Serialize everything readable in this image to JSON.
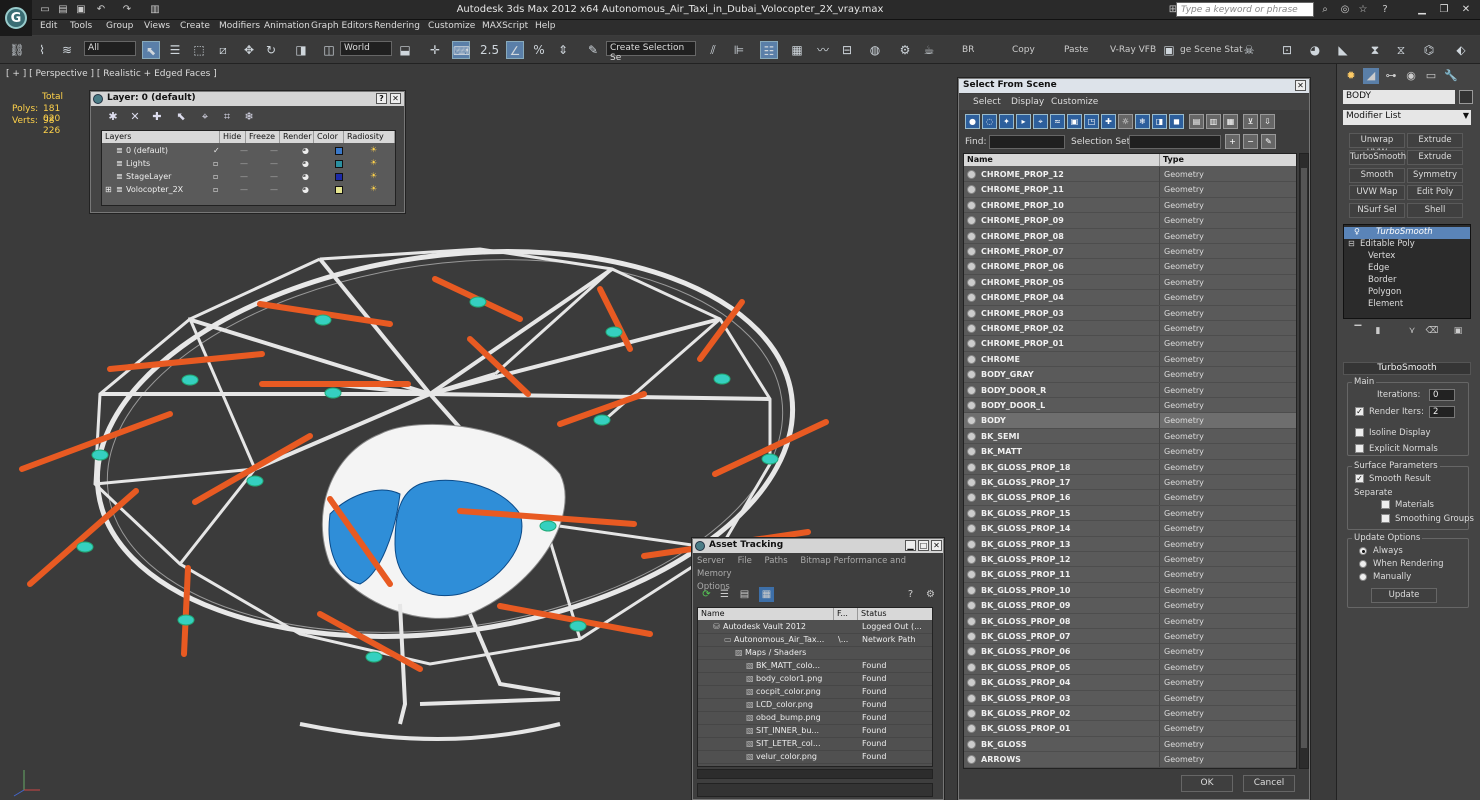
{
  "window": {
    "title": "Autodesk 3ds Max  2012 x64     Autonomous_Air_Taxi_in_Dubai_Volocopter_2X_vray.max",
    "search_placeholder": "Type a keyword or phrase"
  },
  "menu": [
    "Edit",
    "Tools",
    "Group",
    "Views",
    "Create",
    "Modifiers",
    "Animation",
    "Graph Editors",
    "Rendering",
    "Customize",
    "MAXScript",
    "Help"
  ],
  "toolbar": {
    "selection_filter": "All",
    "coord_system": "World",
    "snap_value": "2.5",
    "named_selection_placeholder": "Create Selection Se",
    "br_label": "BR",
    "copy_label": "Copy",
    "paste_label": "Paste",
    "vray_vfb_label": "V-Ray VFB",
    "scene_states_label": "ge Scene Stat"
  },
  "viewport": {
    "label": "[ + ] [ Perspective ] [ Realistic + Edged Faces ]",
    "stats": {
      "total_label": "Total",
      "polys_label": "Polys:",
      "polys_value": "181 020",
      "verts_label": "Verts:",
      "verts_value": "98 226"
    }
  },
  "layer_dialog": {
    "title": "Layer: 0 (default)",
    "columns": [
      "Layers",
      "Hide",
      "Freeze",
      "Render",
      "Color",
      "Radiosity"
    ],
    "rows": [
      {
        "name": "0 (default)",
        "current": "✓",
        "color": "#3a78c8"
      },
      {
        "name": "Lights",
        "current": "",
        "color": "#2a8fa0"
      },
      {
        "name": "StageLayer",
        "current": "",
        "color": "#1c2aa8"
      },
      {
        "name": "Volocopter_2X",
        "current": "",
        "color": "#e8e890"
      }
    ]
  },
  "select_from_scene": {
    "title": "Select From Scene",
    "menu": [
      "Select",
      "Display",
      "Customize"
    ],
    "find_label": "Find:",
    "selection_set_label": "Selection Set:",
    "col_name": "Name",
    "col_type": "Type",
    "ok_label": "OK",
    "cancel_label": "Cancel",
    "objects": [
      {
        "name": "CHROME_PROP_12",
        "type": "Geometry"
      },
      {
        "name": "CHROME_PROP_11",
        "type": "Geometry"
      },
      {
        "name": "CHROME_PROP_10",
        "type": "Geometry"
      },
      {
        "name": "CHROME_PROP_09",
        "type": "Geometry"
      },
      {
        "name": "CHROME_PROP_08",
        "type": "Geometry"
      },
      {
        "name": "CHROME_PROP_07",
        "type": "Geometry"
      },
      {
        "name": "CHROME_PROP_06",
        "type": "Geometry"
      },
      {
        "name": "CHROME_PROP_05",
        "type": "Geometry"
      },
      {
        "name": "CHROME_PROP_04",
        "type": "Geometry"
      },
      {
        "name": "CHROME_PROP_03",
        "type": "Geometry"
      },
      {
        "name": "CHROME_PROP_02",
        "type": "Geometry"
      },
      {
        "name": "CHROME_PROP_01",
        "type": "Geometry"
      },
      {
        "name": "CHROME",
        "type": "Geometry"
      },
      {
        "name": "BODY_GRAY",
        "type": "Geometry"
      },
      {
        "name": "BODY_DOOR_R",
        "type": "Geometry"
      },
      {
        "name": "BODY_DOOR_L",
        "type": "Geometry"
      },
      {
        "name": "BODY",
        "type": "Geometry",
        "selected": true
      },
      {
        "name": "BK_SEMI",
        "type": "Geometry"
      },
      {
        "name": "BK_MATT",
        "type": "Geometry"
      },
      {
        "name": "BK_GLOSS_PROP_18",
        "type": "Geometry"
      },
      {
        "name": "BK_GLOSS_PROP_17",
        "type": "Geometry"
      },
      {
        "name": "BK_GLOSS_PROP_16",
        "type": "Geometry"
      },
      {
        "name": "BK_GLOSS_PROP_15",
        "type": "Geometry"
      },
      {
        "name": "BK_GLOSS_PROP_14",
        "type": "Geometry"
      },
      {
        "name": "BK_GLOSS_PROP_13",
        "type": "Geometry"
      },
      {
        "name": "BK_GLOSS_PROP_12",
        "type": "Geometry"
      },
      {
        "name": "BK_GLOSS_PROP_11",
        "type": "Geometry"
      },
      {
        "name": "BK_GLOSS_PROP_10",
        "type": "Geometry"
      },
      {
        "name": "BK_GLOSS_PROP_09",
        "type": "Geometry"
      },
      {
        "name": "BK_GLOSS_PROP_08",
        "type": "Geometry"
      },
      {
        "name": "BK_GLOSS_PROP_07",
        "type": "Geometry"
      },
      {
        "name": "BK_GLOSS_PROP_06",
        "type": "Geometry"
      },
      {
        "name": "BK_GLOSS_PROP_05",
        "type": "Geometry"
      },
      {
        "name": "BK_GLOSS_PROP_04",
        "type": "Geometry"
      },
      {
        "name": "BK_GLOSS_PROP_03",
        "type": "Geometry"
      },
      {
        "name": "BK_GLOSS_PROP_02",
        "type": "Geometry"
      },
      {
        "name": "BK_GLOSS_PROP_01",
        "type": "Geometry"
      },
      {
        "name": "BK_GLOSS",
        "type": "Geometry"
      },
      {
        "name": "ARROWS",
        "type": "Geometry"
      }
    ]
  },
  "asset_tracking": {
    "title": "Asset Tracking",
    "menu": [
      "Server",
      "File",
      "Paths",
      "Bitmap Performance and Memory",
      "Options"
    ],
    "col_name": "Name",
    "col_path": "F...",
    "col_status": "Status",
    "rows": [
      {
        "name": "Autodesk Vault 2012",
        "path": "",
        "status": "Logged Out (...",
        "indent": 1
      },
      {
        "name": "Autonomous_Air_Tax...",
        "path": "\\...",
        "status": "Network Path",
        "indent": 2
      },
      {
        "name": "Maps / Shaders",
        "path": "",
        "status": "",
        "indent": 3
      },
      {
        "name": "BK_MATT_colo...",
        "path": "",
        "status": "Found",
        "indent": 4
      },
      {
        "name": "body_color1.png",
        "path": "",
        "status": "Found",
        "indent": 4
      },
      {
        "name": "cocpit_color.png",
        "path": "",
        "status": "Found",
        "indent": 4
      },
      {
        "name": "LCD_color.png",
        "path": "",
        "status": "Found",
        "indent": 4
      },
      {
        "name": "obod_bump.png",
        "path": "",
        "status": "Found",
        "indent": 4
      },
      {
        "name": "SIT_INNER_bu...",
        "path": "",
        "status": "Found",
        "indent": 4
      },
      {
        "name": "SIT_LETER_col...",
        "path": "",
        "status": "Found",
        "indent": 4
      },
      {
        "name": "velur_color.png",
        "path": "",
        "status": "Found",
        "indent": 4
      }
    ]
  },
  "command_panel": {
    "object_name": "BODY",
    "modifier_list": "Modifier List",
    "buttons": [
      "Unwrap UVW",
      "Extrude",
      "TurboSmooth",
      "Extrude",
      "Smooth",
      "Symmetry",
      "UVW Map",
      "Edit Poly",
      "NSurf Sel",
      "Shell"
    ],
    "stack": [
      "TurboSmooth",
      "Editable Poly",
      "Vertex",
      "Edge",
      "Border",
      "Polygon",
      "Element"
    ],
    "turbosmooth": {
      "header": "TurboSmooth",
      "main_label": "Main",
      "iterations_label": "Iterations:",
      "iterations_value": "0",
      "render_iters_label": "Render Iters:",
      "render_iters_value": "2",
      "isoline_label": "Isoline Display",
      "explicit_normals_label": "Explicit Normals",
      "surface_params_label": "Surface Parameters",
      "smooth_result_label": "Smooth Result",
      "separate_label": "Separate",
      "materials_label": "Materials",
      "smoothing_groups_label": "Smoothing Groups",
      "update_options_label": "Update Options",
      "always_label": "Always",
      "when_rendering_label": "When Rendering",
      "manually_label": "Manually",
      "update_button": "Update"
    }
  }
}
